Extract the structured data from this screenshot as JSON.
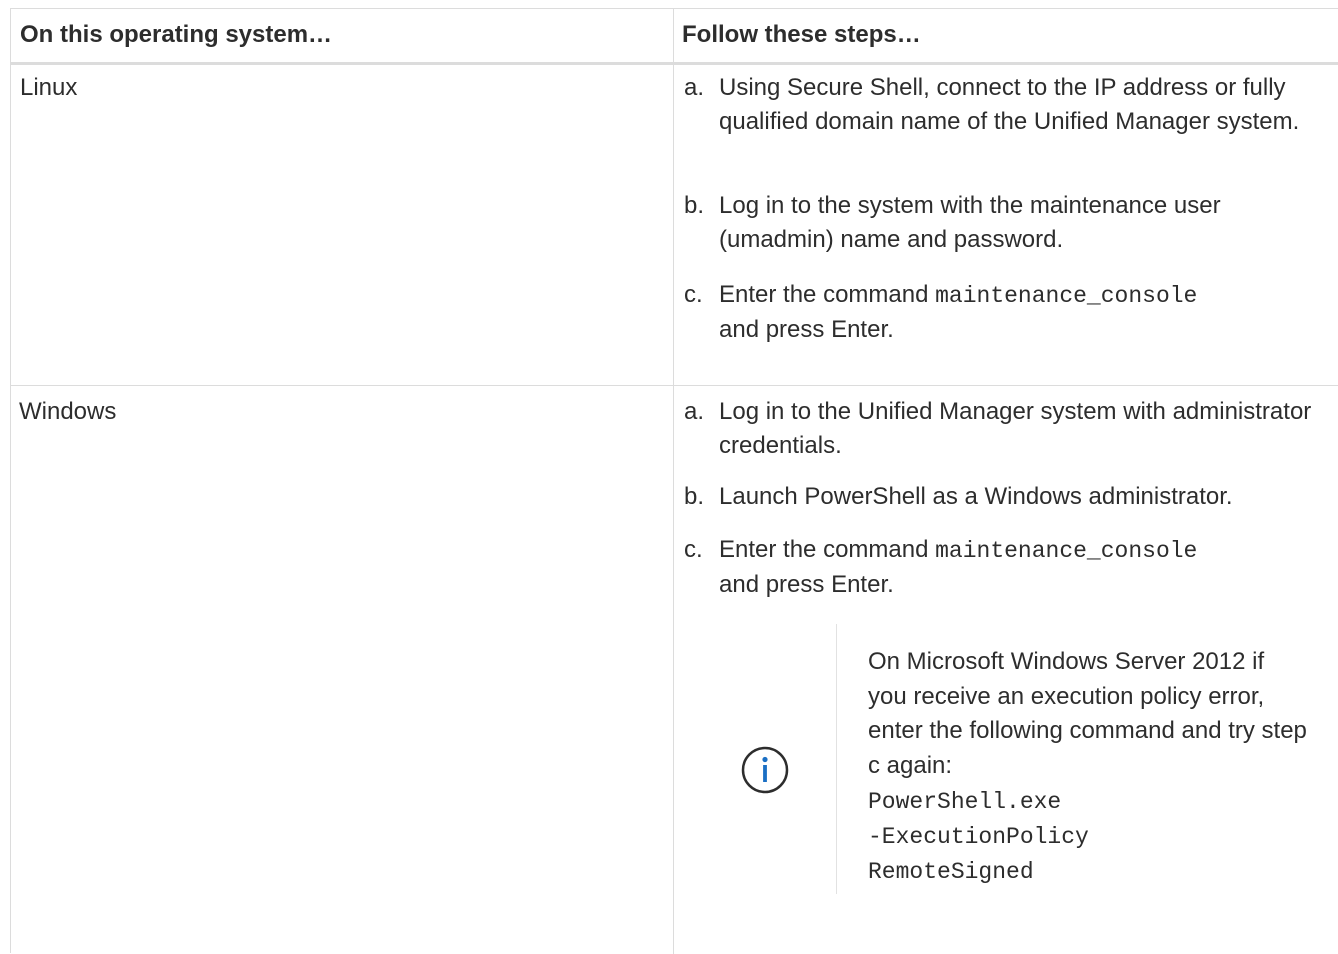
{
  "table": {
    "headers": [
      "On this operating system…",
      "Follow these steps…"
    ],
    "rows": [
      {
        "os": "Linux",
        "steps": [
          {
            "marker": "a.",
            "text": "Using Secure Shell, connect to the IP address or fully qualified domain name of the Unified Manager system."
          },
          {
            "marker": "b.",
            "text": "Log in to the system with the maintenance user (umadmin) name and password."
          },
          {
            "marker": "c.",
            "pre": "Enter the command ",
            "code": "maintenance_console",
            "post": "and press Enter."
          }
        ]
      },
      {
        "os": "Windows",
        "steps": [
          {
            "marker": "a.",
            "text": "Log in to the Unified Manager system with administrator credentials."
          },
          {
            "marker": "b.",
            "text": "Launch PowerShell as a Windows administrator."
          },
          {
            "marker": "c.",
            "pre": "Enter the command ",
            "code": "maintenance_console",
            "post": "and press Enter."
          }
        ],
        "note": {
          "icon": "info-icon",
          "text": "On Microsoft Windows Server 2012 if you receive an execution policy error, enter the following command and try step c again:",
          "code_lines": [
            "PowerShell.exe",
            "-ExecutionPolicy",
            "RemoteSigned"
          ]
        }
      }
    ]
  },
  "colors": {
    "border": "#dcdcdc",
    "text": "#2d2d2d",
    "info_icon": "#1a6fc4"
  }
}
